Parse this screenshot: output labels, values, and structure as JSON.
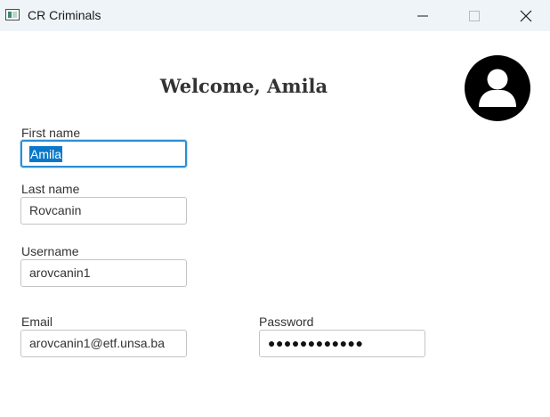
{
  "window": {
    "title": "CR Criminals",
    "icon": "app-window-icon",
    "controls": [
      "minimize-icon",
      "maximize-icon",
      "close-icon"
    ]
  },
  "header": {
    "welcome": "Welcome, Amila",
    "avatar_icon": "user-avatar-icon"
  },
  "form": {
    "first_name": {
      "label": "First name",
      "value": "Amila",
      "focused": true,
      "selected": true
    },
    "last_name": {
      "label": "Last name",
      "value": "Rovcanin"
    },
    "username": {
      "label": "Username",
      "value": "arovcanin1"
    },
    "email": {
      "label": "Email",
      "value": "arovcanin1@etf.unsa.ba"
    },
    "password": {
      "label": "Password",
      "masked_value": "●●●●●●●●●●●●"
    }
  },
  "colors": {
    "titlebar": "#eff4f9",
    "focus_border": "#2a8fd4",
    "selection": "#0a78c8",
    "avatar": "#000000"
  }
}
